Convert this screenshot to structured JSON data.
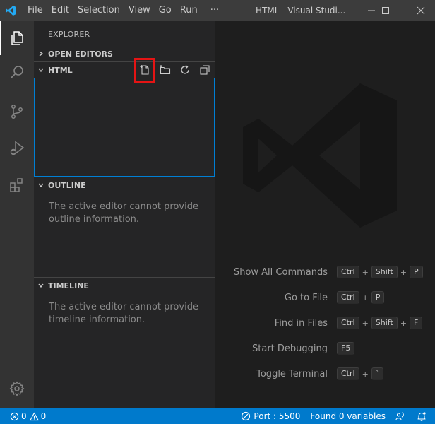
{
  "titlebar": {
    "menu": [
      "File",
      "Edit",
      "Selection",
      "View",
      "Go",
      "Run",
      "···"
    ],
    "title": "HTML - Visual Studi..."
  },
  "activitybar": {
    "items": [
      "explorer-icon",
      "search-icon",
      "source-control-icon",
      "run-debug-icon",
      "extensions-icon"
    ],
    "bottom": "settings-gear-icon"
  },
  "sidebar": {
    "title": "EXPLORER",
    "sections": {
      "open_editors": "OPEN EDITORS",
      "folder": "HTML",
      "outline": "OUTLINE",
      "timeline": "TIMELINE"
    },
    "folder_actions": [
      "new-file-icon",
      "new-folder-icon",
      "refresh-icon",
      "collapse-all-icon"
    ],
    "outline_message": "The active editor cannot provide outline information.",
    "timeline_message": "The active editor cannot provide timeline information."
  },
  "editor": {
    "shortcuts": [
      {
        "label": "Show All Commands",
        "keys": [
          "Ctrl",
          "Shift",
          "P"
        ]
      },
      {
        "label": "Go to File",
        "keys": [
          "Ctrl",
          "P"
        ]
      },
      {
        "label": "Find in Files",
        "keys": [
          "Ctrl",
          "Shift",
          "F"
        ]
      },
      {
        "label": "Start Debugging",
        "keys": [
          "F5"
        ]
      },
      {
        "label": "Toggle Terminal",
        "keys": [
          "Ctrl",
          "`"
        ]
      }
    ]
  },
  "statusbar": {
    "errors": "0",
    "warnings": "0",
    "port": "Port : 5500",
    "variables": "Found 0 variables"
  },
  "colors": {
    "accent": "#007acc",
    "highlight": "#e51414",
    "focus_border": "#007fd4"
  }
}
